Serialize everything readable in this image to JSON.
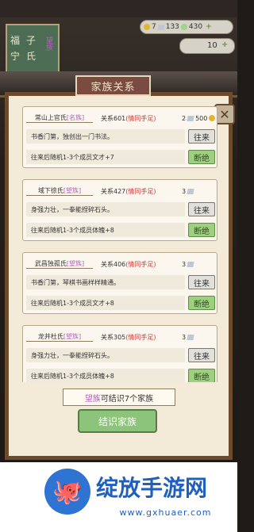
{
  "topbar": {
    "gold": "7",
    "silver": "133",
    "token": "430",
    "plus": "+",
    "side_value": "10"
  },
  "left_plate": {
    "chars": [
      "福",
      "子",
      "宁",
      "氏"
    ],
    "side_text": "望族"
  },
  "modal": {
    "title": "家族关系",
    "close_icon": "close-icon",
    "cards": [
      {
        "name": "常山上官氏",
        "rank": "[名族]",
        "relation": "关系601",
        "relation_tag": "(情同手足)",
        "cost": "2",
        "reward": "500",
        "desc": "书香门第，独创出一门书法。",
        "effect": "往来后随机1-3个成员文才+7",
        "go": "往来",
        "cut": "断绝"
      },
      {
        "name": "域下徐氏",
        "rank": "[望族]",
        "relation": "关系427",
        "relation_tag": "(情同手足)",
        "cost": "3",
        "desc": "身强力壮，一拳能捏碎石头。",
        "effect": "往来后随机1-3个成员体魄+8",
        "go": "往来",
        "cut": "断绝"
      },
      {
        "name": "武昌独孤氏",
        "rank": "[望族]",
        "relation": "关系406",
        "relation_tag": "(情同手足)",
        "cost": "3",
        "desc": "书香门第，琴棋书画样样精通。",
        "effect": "往来后随机1-3个成员文才+8",
        "go": "往来",
        "cut": "断绝"
      },
      {
        "name": "龙井杜氏",
        "rank": "[望族]",
        "relation": "关系305",
        "relation_tag": "(情同手足)",
        "cost": "3",
        "desc": "身强力壮，一拳能捏碎石头。",
        "effect": "往来后随机1-3个成员体魄+8",
        "go": "往来",
        "cut": "断绝"
      }
    ],
    "info_prefix": "望族",
    "info_text": "可结识7个家族",
    "make_button": "结识家族"
  },
  "watermark": {
    "brand": "绽放手游网",
    "url": "www.gxhuaer.com",
    "logo_icon": "octopus-icon"
  },
  "colors": {
    "frame": "#6c4a2d",
    "paper": "#f3ead7",
    "green_button": "#9fd07f",
    "pink_rank": "#b95cc6",
    "red_tag": "#cc3b3b",
    "brand_blue": "#1f5fbf"
  }
}
